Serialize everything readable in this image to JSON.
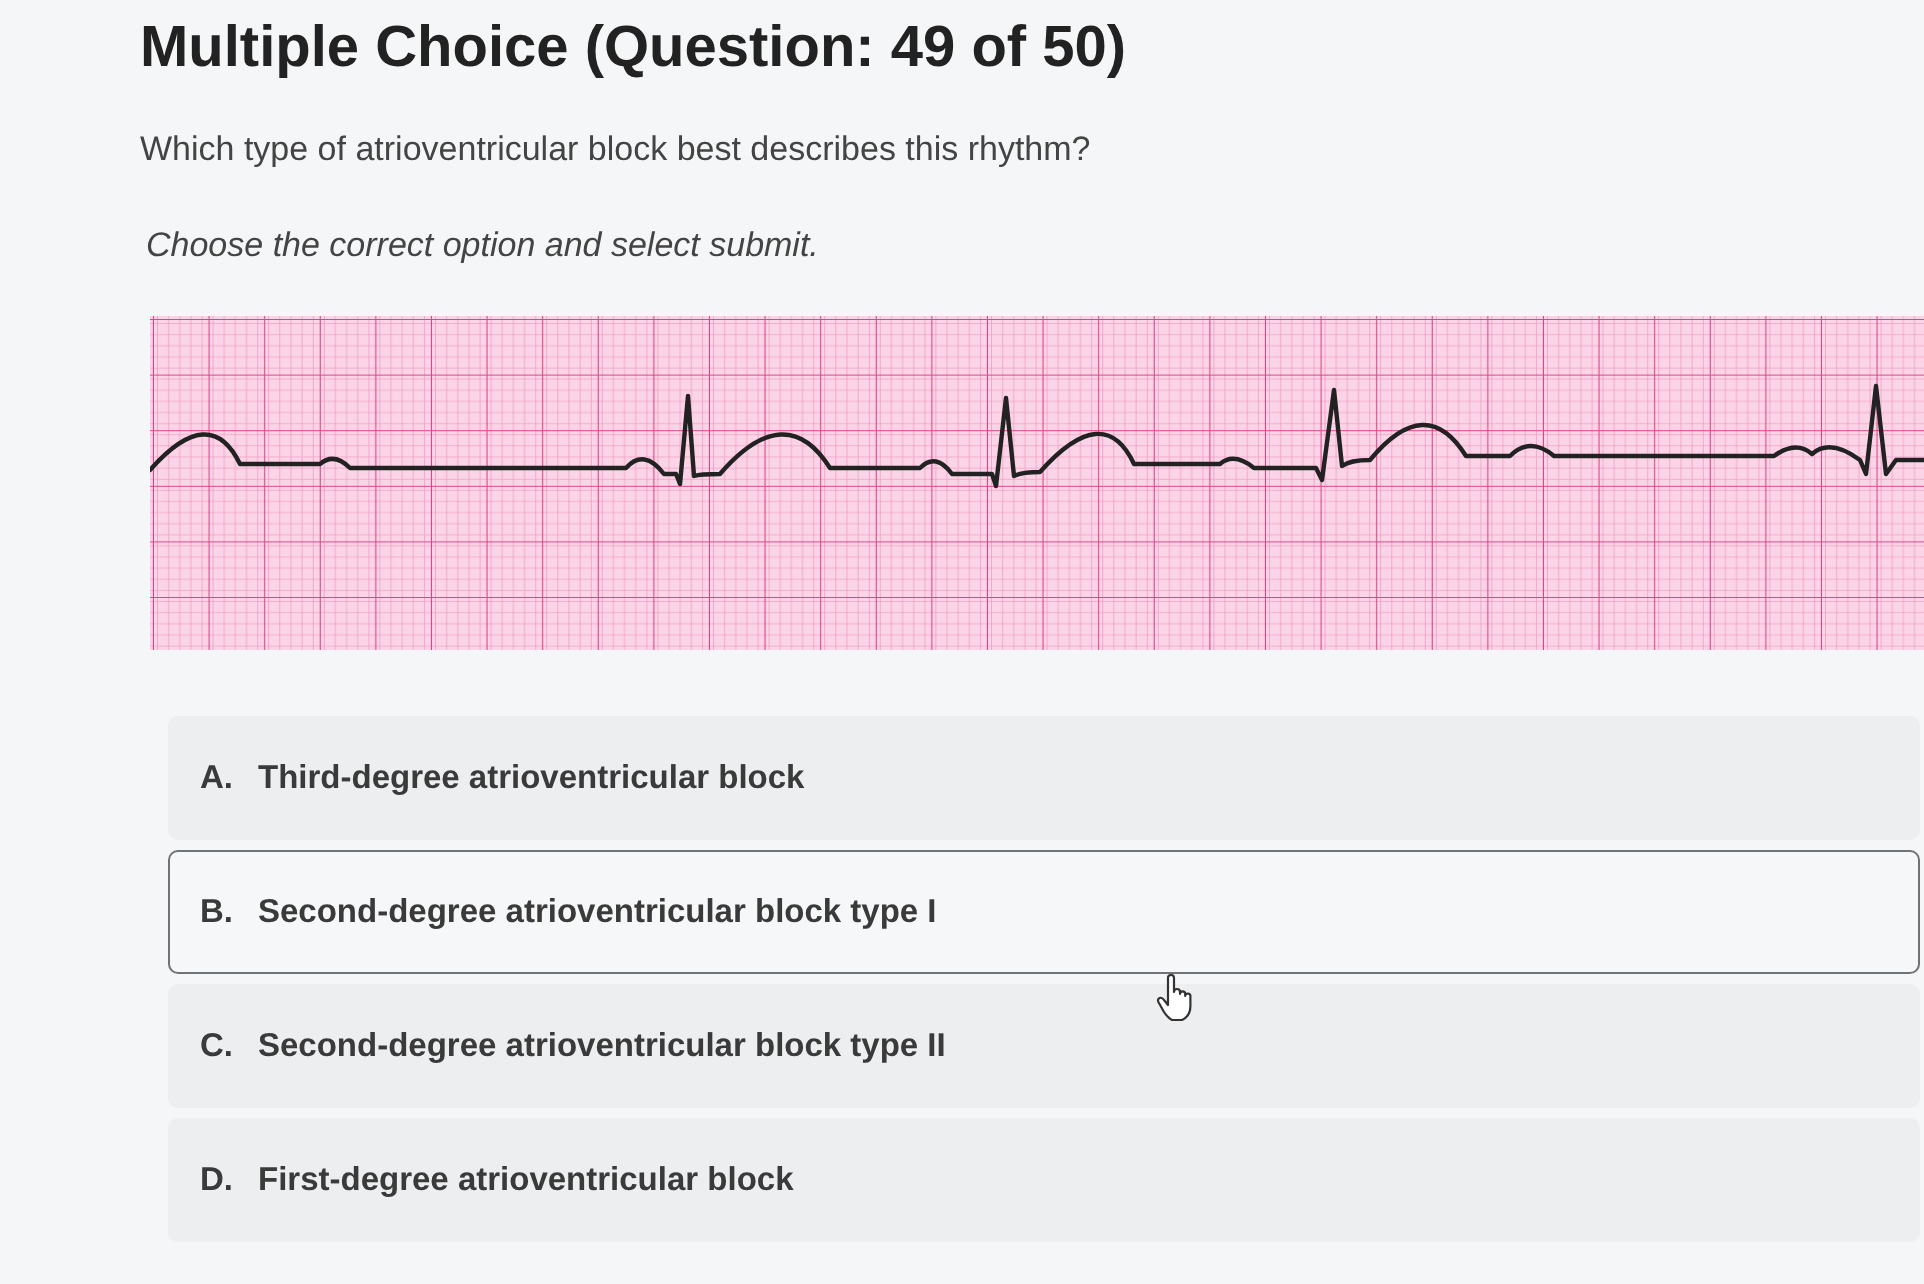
{
  "header": {
    "title": "Multiple Choice (Question: 49 of 50)"
  },
  "question": {
    "prompt": "Which type of atrioventricular block best describes this rhythm?",
    "instruction": "Choose the correct option and select submit."
  },
  "options": [
    {
      "letter": "A.",
      "text": "Third-degree atrioventricular block",
      "selected": false
    },
    {
      "letter": "B.",
      "text": "Second-degree atrioventricular block type I",
      "selected": true
    },
    {
      "letter": "C.",
      "text": "Second-degree atrioventricular block type II",
      "selected": false
    },
    {
      "letter": "D.",
      "text": "First-degree atrioventricular block",
      "selected": false
    }
  ]
}
